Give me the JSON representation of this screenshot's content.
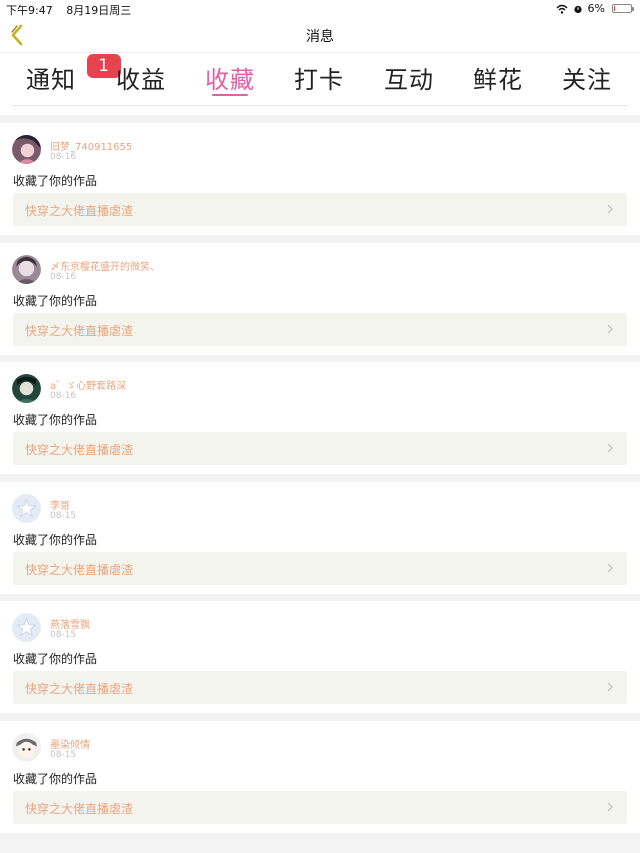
{
  "status": {
    "time": "下午9:47",
    "date": "8月19日周三",
    "battery": "6%",
    "battery_level": 0.06
  },
  "nav": {
    "title": "消息"
  },
  "tabs": [
    {
      "label": "通知",
      "badge": "1"
    },
    {
      "label": "收益"
    },
    {
      "label": "收藏",
      "active": true
    },
    {
      "label": "打卡"
    },
    {
      "label": "互动"
    },
    {
      "label": "鲜花"
    },
    {
      "label": "关注"
    }
  ],
  "items": [
    {
      "user": "旧梦_740911655",
      "date": "08-16",
      "action": "收藏了你的作品",
      "work": "快穿之大佬直播虐渣",
      "avatar": "photo-pink"
    },
    {
      "user": "〆东京樱花盛开的微笑、",
      "date": "08-16",
      "action": "收藏了你的作品",
      "work": "快穿之大佬直播虐渣",
      "avatar": "photo-dark"
    },
    {
      "user": "a゛ゞ心野套路深",
      "date": "08-16",
      "action": "收藏了你的作品",
      "work": "快穿之大佬直播虐渣",
      "avatar": "photo-green"
    },
    {
      "user": "李哥",
      "date": "08-15",
      "action": "收藏了你的作品",
      "work": "快穿之大佬直播虐渣",
      "avatar": "default-star"
    },
    {
      "user": "燕落雪飘",
      "date": "08-15",
      "action": "收藏了你的作品",
      "work": "快穿之大佬直播虐渣",
      "avatar": "default-star"
    },
    {
      "user": "墨染倾情",
      "date": "08-15",
      "action": "收藏了你的作品",
      "work": "快穿之大佬直播虐渣",
      "avatar": "photo-cartoon"
    }
  ],
  "colors": {
    "accent": "#e061a6",
    "name": "#e9a57c",
    "badge": "#e8424f"
  }
}
